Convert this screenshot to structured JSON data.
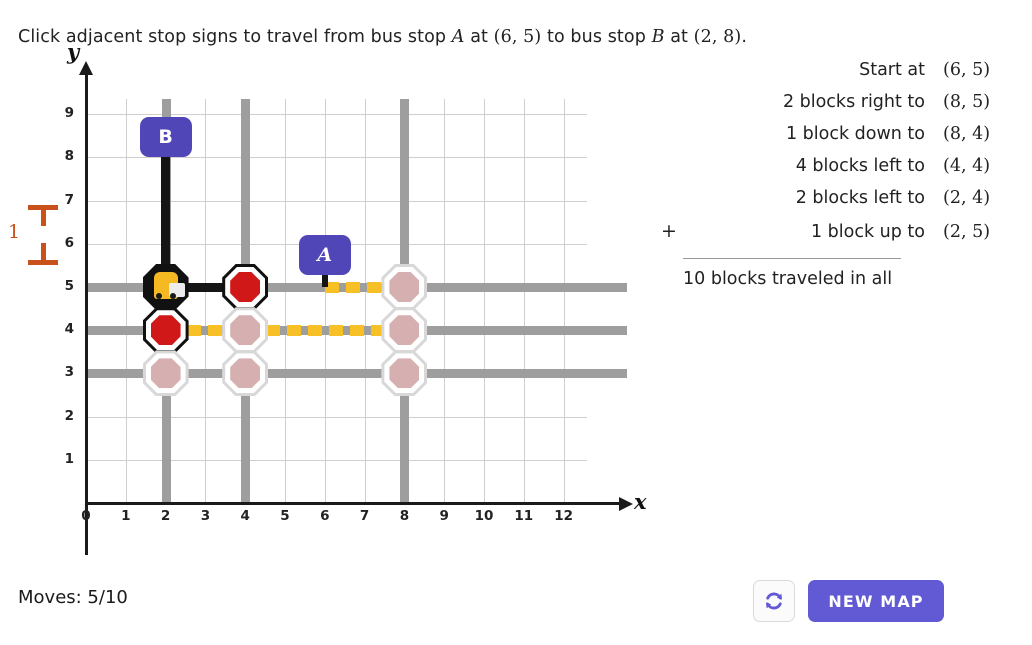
{
  "prompt": {
    "seg1": "Click adjacent stop signs to travel from bus stop ",
    "a": "A",
    "seg2": " at ",
    "a_coord": "(6, 5)",
    "seg3": " to bus stop ",
    "b": "B",
    "seg4": " at ",
    "b_coord": "(2, 8)",
    "seg5": "."
  },
  "chart_data": {
    "type": "scatter",
    "title": "",
    "xlabel": "x",
    "ylabel": "y",
    "xlim": [
      0,
      12
    ],
    "ylim": [
      0,
      9
    ],
    "xticks": [
      "0",
      "1",
      "2",
      "3",
      "4",
      "5",
      "6",
      "7",
      "8",
      "9",
      "10",
      "11",
      "12"
    ],
    "yticks": [
      "1",
      "2",
      "3",
      "4",
      "5",
      "6",
      "7",
      "8",
      "9"
    ],
    "grid": true,
    "unit_label": "1",
    "roads_vertical_x": [
      2,
      4,
      8
    ],
    "roads_horizontal_y": [
      3,
      4,
      5
    ],
    "stops": [
      {
        "x": 2,
        "y": 5,
        "state": "bus"
      },
      {
        "x": 4,
        "y": 5,
        "state": "active"
      },
      {
        "x": 8,
        "y": 5,
        "state": "faded"
      },
      {
        "x": 2,
        "y": 4,
        "state": "active"
      },
      {
        "x": 4,
        "y": 4,
        "state": "faded"
      },
      {
        "x": 8,
        "y": 4,
        "state": "faded"
      },
      {
        "x": 2,
        "y": 3,
        "state": "faded"
      },
      {
        "x": 4,
        "y": 3,
        "state": "faded"
      },
      {
        "x": 8,
        "y": 3,
        "state": "faded"
      }
    ],
    "marker_a": {
      "label": "A",
      "x": 6,
      "y": 5
    },
    "marker_b": {
      "label": "B",
      "x": 2,
      "y": 8
    },
    "travelled_path": [
      [
        6,
        5
      ],
      [
        8,
        5
      ],
      [
        8,
        4
      ],
      [
        4,
        4
      ],
      [
        2,
        4
      ],
      [
        2,
        5
      ]
    ],
    "solid_path": [
      [
        2,
        8
      ],
      [
        2,
        5
      ],
      [
        4,
        5
      ]
    ]
  },
  "receipt": {
    "rows": [
      {
        "plus": "",
        "desc": "Start at",
        "coord": "(6, 5)"
      },
      {
        "plus": "",
        "desc": "2 blocks right to",
        "coord": "(8, 5)"
      },
      {
        "plus": "",
        "desc": "1 block down to",
        "coord": "(8, 4)"
      },
      {
        "plus": "",
        "desc": "4 blocks left to",
        "coord": "(4, 4)"
      },
      {
        "plus": "",
        "desc": "2 blocks left to",
        "coord": "(2, 4)"
      },
      {
        "plus": "+",
        "desc": "1 block up to",
        "coord": "(2, 5)"
      }
    ],
    "total": "10 blocks traveled in all"
  },
  "footer": {
    "moves_label": "Moves: 5/10",
    "reset_icon": "refresh-icon",
    "new_map_label": "NEW MAP"
  },
  "colors": {
    "purple": "#5046b8",
    "button_purple": "#6259d4",
    "stop_red": "#d01818",
    "stop_faded": "#d6b0b0",
    "road_gray": "#9e9e9e",
    "path_yellow": "#f6c026",
    "measure_orange": "#c9521c",
    "bus_yellow": "#f5b922"
  }
}
